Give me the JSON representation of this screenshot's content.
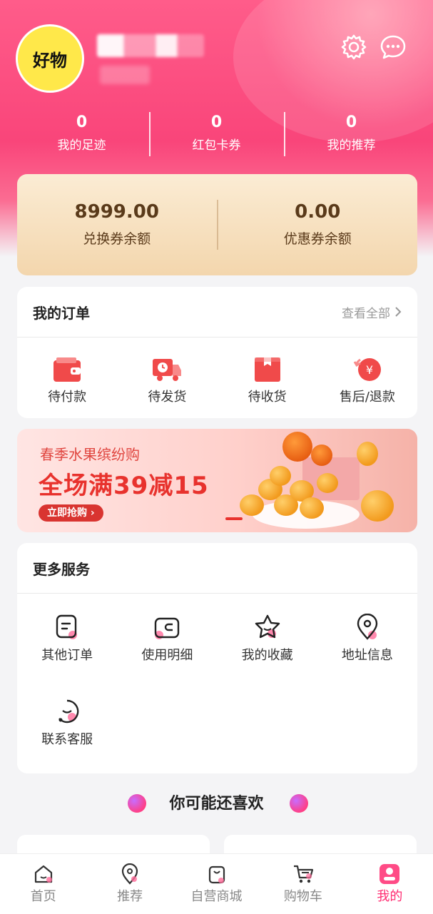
{
  "profile": {
    "avatar_text": "好物"
  },
  "stats": [
    {
      "value": "0",
      "label": "我的足迹"
    },
    {
      "value": "0",
      "label": "红包卡券"
    },
    {
      "value": "0",
      "label": "我的推荐"
    }
  ],
  "balance": [
    {
      "amount": "8999.00",
      "label": "兑换券余额"
    },
    {
      "amount": "0.00",
      "label": "优惠券余额"
    }
  ],
  "orders": {
    "title": "我的订单",
    "view_all": "查看全部",
    "items": [
      {
        "label": "待付款",
        "icon": "wallet-icon"
      },
      {
        "label": "待发货",
        "icon": "delivery-truck-icon"
      },
      {
        "label": "待收货",
        "icon": "package-icon"
      },
      {
        "label": "售后/退款",
        "icon": "refund-icon"
      }
    ]
  },
  "banner": {
    "subtitle": "春季水果缤纷购",
    "headline": "全场满39减15",
    "button": "立即抢购"
  },
  "services": {
    "title": "更多服务",
    "items": [
      {
        "label": "其他订单",
        "icon": "order-list-icon"
      },
      {
        "label": "使用明细",
        "icon": "card-detail-icon"
      },
      {
        "label": "我的收藏",
        "icon": "star-icon"
      },
      {
        "label": "地址信息",
        "icon": "location-icon"
      },
      {
        "label": "联系客服",
        "icon": "customer-service-icon"
      }
    ]
  },
  "recommend": {
    "title": "你可能还喜欢"
  },
  "tabbar": [
    {
      "label": "首页",
      "icon": "home-icon",
      "active": false
    },
    {
      "label": "推荐",
      "icon": "location-pin-icon",
      "active": false
    },
    {
      "label": "自营商城",
      "icon": "shopping-bag-icon",
      "active": false
    },
    {
      "label": "购物车",
      "icon": "cart-icon",
      "active": false
    },
    {
      "label": "我的",
      "icon": "profile-icon",
      "active": true
    }
  ],
  "colors": {
    "accent": "#ff2d72",
    "hero": "#f9457a",
    "balance_text": "#5a3a1a"
  }
}
